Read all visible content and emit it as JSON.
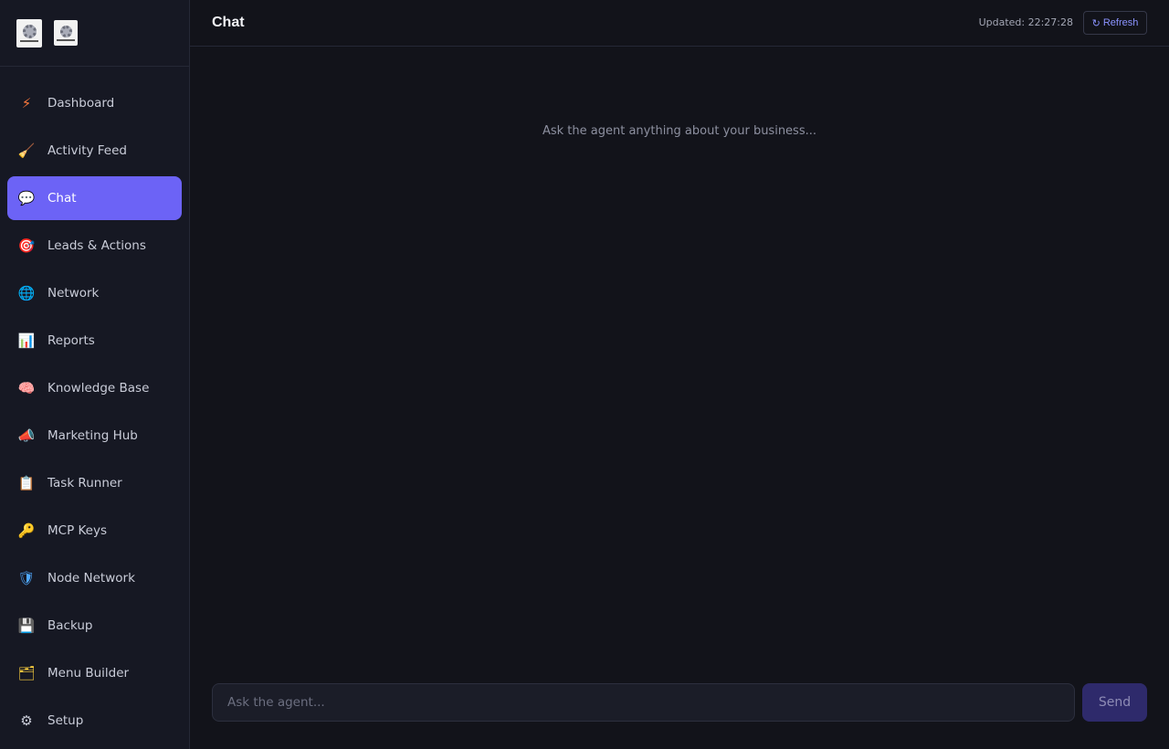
{
  "sidebar": {
    "items": [
      {
        "label": "Dashboard",
        "icon": "lightning-icon",
        "glyph": "⚡",
        "color": "#ff7a3d"
      },
      {
        "label": "Activity Feed",
        "icon": "broom-icon",
        "glyph": "🧹",
        "color": "#c8c8d8"
      },
      {
        "label": "Chat",
        "icon": "speech-bubble-icon",
        "glyph": "💬",
        "color": "#e8e8ff",
        "active": true
      },
      {
        "label": "Leads & Actions",
        "icon": "target-icon",
        "glyph": "🎯",
        "color": "#ff4d6d"
      },
      {
        "label": "Network",
        "icon": "globe-icon",
        "glyph": "🌐",
        "color": "#4fb3ff"
      },
      {
        "label": "Reports",
        "icon": "bar-chart-icon",
        "glyph": "📊",
        "color": "#6fa8ff"
      },
      {
        "label": "Knowledge Base",
        "icon": "brain-icon",
        "glyph": "🧠",
        "color": "#ff8fc8"
      },
      {
        "label": "Marketing Hub",
        "icon": "megaphone-icon",
        "glyph": "📣",
        "color": "#ffb347"
      },
      {
        "label": "Task Runner",
        "icon": "clipboard-icon",
        "glyph": "📋",
        "color": "#e8b07a"
      },
      {
        "label": "MCP Keys",
        "icon": "key-icon",
        "glyph": "🔑",
        "color": "#f5c242"
      },
      {
        "label": "Node Network",
        "icon": "shield-icon",
        "glyph": "🛡",
        "color": "#4fa8ff"
      },
      {
        "label": "Backup",
        "icon": "floppy-disk-icon",
        "glyph": "💾",
        "color": "#a66bff"
      },
      {
        "label": "Menu Builder",
        "icon": "folder-icon",
        "glyph": "🗂",
        "color": "#ffd23f"
      },
      {
        "label": "Setup",
        "icon": "gear-icon",
        "glyph": "⚙",
        "color": "#c9ccd8"
      }
    ]
  },
  "header": {
    "title": "Chat",
    "updated": "Updated: 22:27:28",
    "refresh_label": "Refresh",
    "refresh_icon": "↻"
  },
  "main": {
    "empty_hint": "Ask the agent anything about your business..."
  },
  "composer": {
    "placeholder": "Ask the agent...",
    "value": "",
    "send_label": "Send"
  },
  "colors": {
    "accent": "#6c63f6",
    "background": "#12131a",
    "sidebar": "#161823"
  }
}
